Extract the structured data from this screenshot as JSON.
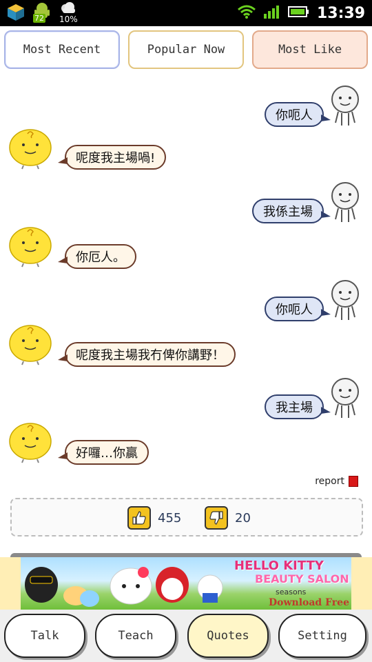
{
  "status_bar": {
    "battery_badge": "72",
    "weather_percent": "10%",
    "time": "13:39",
    "icons": [
      "app-cube-icon",
      "android-icon",
      "cloud-icon",
      "wifi-icon",
      "signal-icon",
      "battery-icon"
    ]
  },
  "tabs": {
    "most_recent": "Most Recent",
    "popular_now": "Popular Now",
    "most_like": "Most Like",
    "selected": "Most Like"
  },
  "conversation": [
    {
      "speaker": "user",
      "text": "你呃人"
    },
    {
      "speaker": "simsimi",
      "text": "呢度我主場喎!"
    },
    {
      "speaker": "user",
      "text": "我係主場"
    },
    {
      "speaker": "simsimi",
      "text": "你厄人。"
    },
    {
      "speaker": "user",
      "text": "你呃人"
    },
    {
      "speaker": "simsimi",
      "text": "呢度我主場我冇俾你講野！"
    },
    {
      "speaker": "user",
      "text": "我主場"
    },
    {
      "speaker": "simsimi",
      "text": "好囉…你贏"
    }
  ],
  "report": {
    "label": "report"
  },
  "votes": {
    "likes": "455",
    "dislikes": "20"
  },
  "ad": {
    "title": "HELLO KITTY",
    "subtitle": "BEAUTY SALON",
    "seasons": "seasons",
    "cta": "Download Free"
  },
  "bottom_nav": {
    "talk": "Talk",
    "teach": "Teach",
    "quotes": "Quotes",
    "setting": "Setting",
    "selected": "Quotes"
  },
  "colors": {
    "user_bubble": "#dfe6f6",
    "simsimi_bubble": "#fff6e8",
    "thumb": "#f3c21f",
    "tab_selected": "#fde7dc",
    "nav_selected": "#fff6c8"
  }
}
